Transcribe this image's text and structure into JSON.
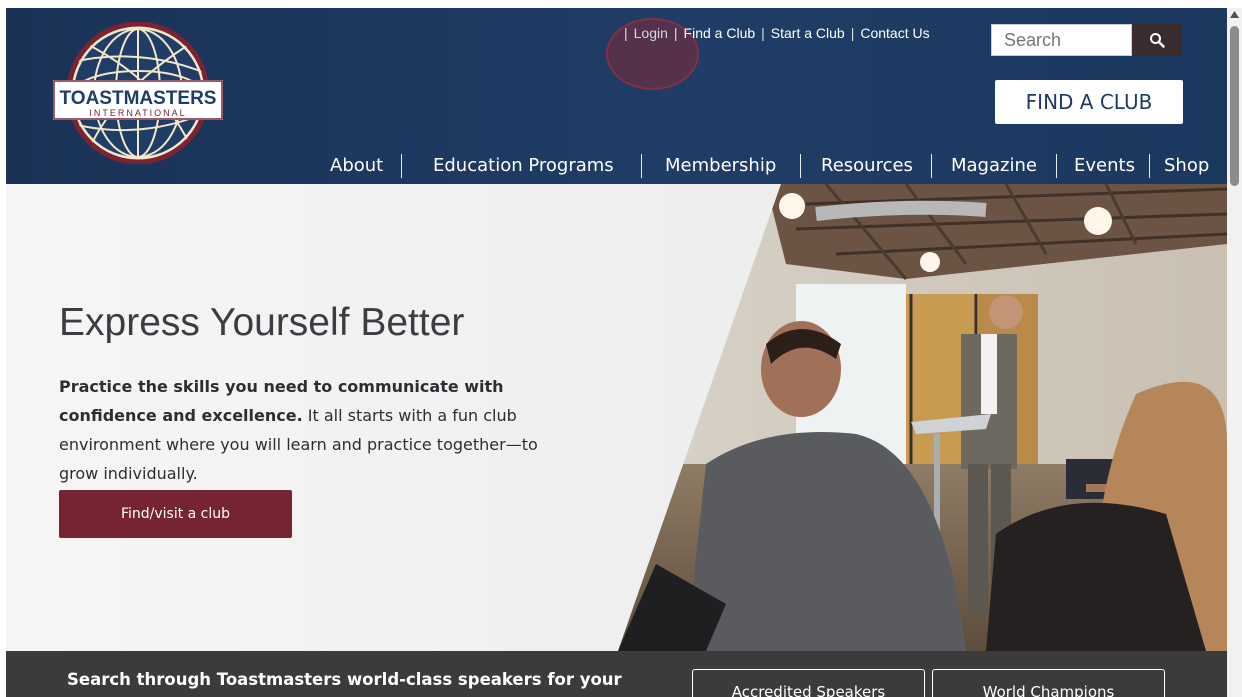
{
  "header": {
    "logo_text": "TOASTMASTERS",
    "logo_subtext": "INTERNATIONAL",
    "utility_links": {
      "login": "Login",
      "find_club": "Find a Club",
      "start_club": "Start a Club",
      "contact": "Contact Us"
    },
    "search": {
      "placeholder": "Search"
    },
    "find_club_button": "FIND A CLUB",
    "nav": {
      "about": "About",
      "education": "Education Programs",
      "membership": "Membership",
      "resources": "Resources",
      "magazine": "Magazine",
      "events": "Events",
      "shop": "Shop"
    }
  },
  "hero": {
    "title": "Express Yourself Better",
    "body_bold": "Practice the skills you need to communicate with confidence and excellence.",
    "body_rest": " It all starts with a fun club environment where you will learn and practice together—to grow individually.",
    "cta": "Find/visit a club"
  },
  "band": {
    "text": "Search through Toastmasters world-class speakers for your",
    "accredited": "Accredited Speakers",
    "champions": "World Champions"
  },
  "colors": {
    "header_navy": "#1f3d66",
    "brand_maroon": "#772432",
    "band_dark": "#3b3b3b"
  }
}
